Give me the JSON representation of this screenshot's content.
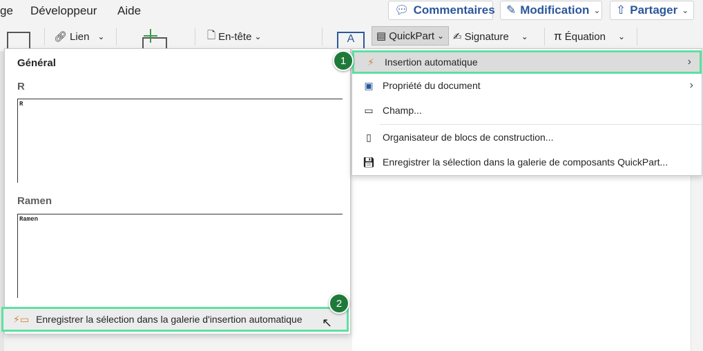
{
  "tabs": [
    "ge",
    "Développeur",
    "Aide"
  ],
  "top_buttons": {
    "comments": "Commentaires",
    "edit": "Modification",
    "share": "Partager"
  },
  "ribbon": {
    "link": "Lien",
    "header": "En-tête",
    "quickpart": "QuickPart",
    "signature": "Signature",
    "equation": "Équation"
  },
  "gallery": {
    "heading": "Général",
    "entries": [
      {
        "name": "R",
        "preview": "R"
      },
      {
        "name": "Ramen",
        "preview": "Ramen"
      }
    ],
    "footer": "Enregistrer la sélection dans la galerie d'insertion automatique"
  },
  "menu": {
    "items": [
      {
        "label": "Insertion automatique",
        "submenu": true
      },
      {
        "label": "Propriété du document",
        "submenu": true
      },
      {
        "label": "Champ...",
        "submenu": false
      },
      {
        "label": "Organisateur de blocs de construction...",
        "submenu": false
      },
      {
        "label": "Enregistrer la sélection dans la galerie de composants QuickPart...",
        "submenu": false
      }
    ]
  },
  "badges": [
    "1",
    "2"
  ],
  "colors": {
    "highlight_border": "#5ee0a1",
    "badge": "#1f7a3a",
    "accent": "#2b579a"
  }
}
